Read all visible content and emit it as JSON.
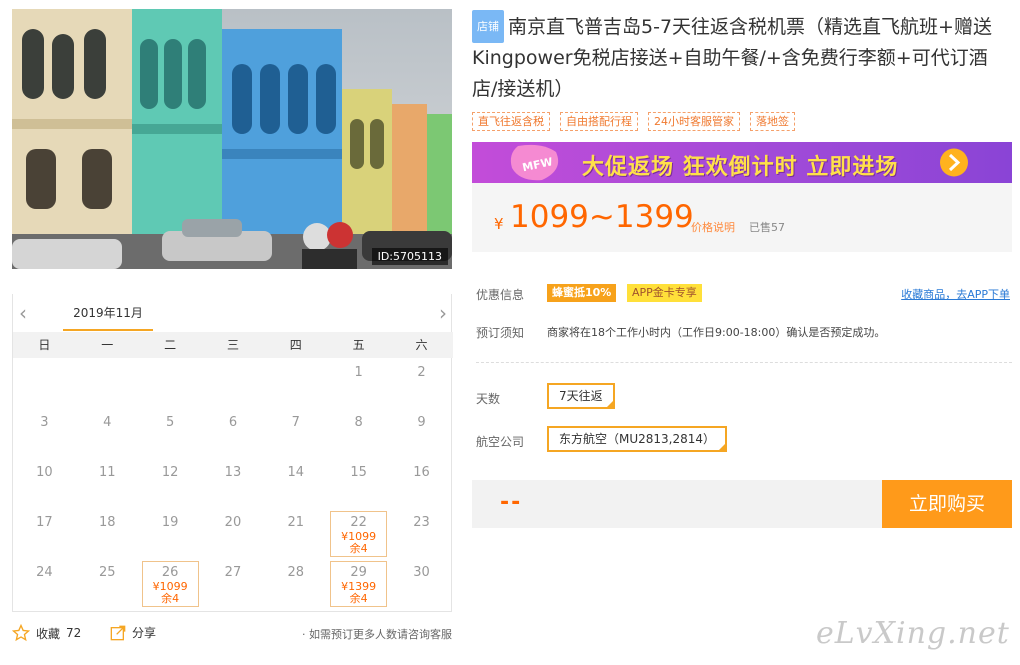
{
  "photo": {
    "id_label": "ID:5705113"
  },
  "calendar": {
    "month_label": "2019年11月",
    "prev_icon": "‹",
    "next_icon": "›",
    "weekdays": [
      "日",
      "一",
      "二",
      "三",
      "四",
      "五",
      "六"
    ],
    "weeks": [
      [
        {
          "d": ""
        },
        {
          "d": ""
        },
        {
          "d": ""
        },
        {
          "d": ""
        },
        {
          "d": ""
        },
        {
          "d": "1"
        },
        {
          "d": "2"
        }
      ],
      [
        {
          "d": "3"
        },
        {
          "d": "4"
        },
        {
          "d": "5"
        },
        {
          "d": "6"
        },
        {
          "d": "7"
        },
        {
          "d": "8"
        },
        {
          "d": "9"
        }
      ],
      [
        {
          "d": "10"
        },
        {
          "d": "11"
        },
        {
          "d": "12"
        },
        {
          "d": "13"
        },
        {
          "d": "14"
        },
        {
          "d": "15"
        },
        {
          "d": "16"
        }
      ],
      [
        {
          "d": "17"
        },
        {
          "d": "18"
        },
        {
          "d": "19"
        },
        {
          "d": "20"
        },
        {
          "d": "21"
        },
        {
          "d": "22",
          "price": "¥1099",
          "stock": "余4"
        },
        {
          "d": "23"
        }
      ],
      [
        {
          "d": "24"
        },
        {
          "d": "25"
        },
        {
          "d": "26",
          "price": "¥1099",
          "stock": "余4"
        },
        {
          "d": "27"
        },
        {
          "d": "28"
        },
        {
          "d": "29",
          "price": "¥1399",
          "stock": "余4"
        },
        {
          "d": "30"
        }
      ]
    ]
  },
  "actions": {
    "fav_label": "收藏",
    "fav_count": "72",
    "share_label": "分享",
    "consult_text": "· 如需预订更多人数请咨询客服"
  },
  "product": {
    "shop_tag": "店铺",
    "title": "南京直飞普吉岛5-7天往返含税机票（精选直飞航班+赠送Kingpower免税店接送+自助午餐/+含免费行李额+可代订酒店/接送机）",
    "tags": [
      "直飞往返含税",
      "自由搭配行程",
      "24小时客服管家",
      "落地签"
    ]
  },
  "banner": {
    "text": "大促返场 狂欢倒计时 立即进场",
    "badge": "MFW"
  },
  "price": {
    "currency": "¥",
    "range": "1099~1399",
    "note_link": "价格说明",
    "sold": "已售57"
  },
  "promo": {
    "label": "优惠信息",
    "coupons": [
      "蜂蜜抵10%",
      "APP金卡专享"
    ],
    "fav_app_link": "收藏商品，去APP下单"
  },
  "booking_notice": {
    "label": "预订须知",
    "text": "商家将在18个工作小时内（工作日9:00-18:00）确认是否预定成功。"
  },
  "options": {
    "days_label": "天数",
    "days_value": "7天往返",
    "airline_label": "航空公司",
    "airline_value": "东方航空（MU2813,2814）"
  },
  "buy": {
    "total": "--",
    "button_label": "立即购买"
  },
  "watermark": "eLvXing.net",
  "colors": {
    "accent": "#ff6600",
    "button": "#ff9a1a",
    "border": "#f5a623"
  }
}
